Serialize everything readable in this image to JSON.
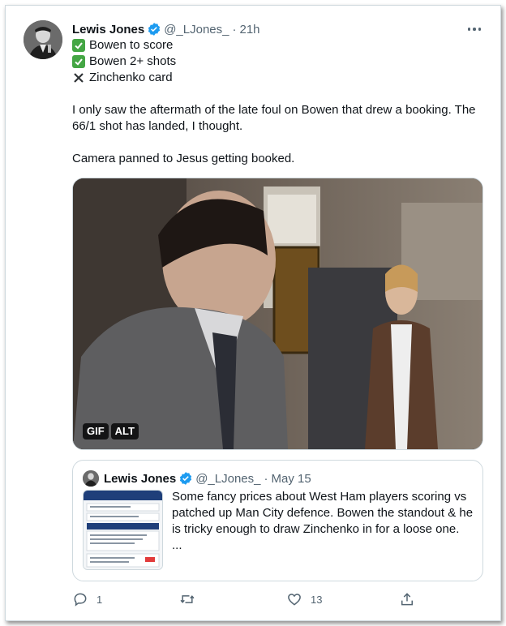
{
  "tweet": {
    "author_name": "Lewis Jones",
    "handle": "@_LJones_",
    "separator": "·",
    "time": "21h",
    "lines": [
      {
        "mark": "check",
        "text": "Bowen to score"
      },
      {
        "mark": "check",
        "text": "Bowen 2+ shots"
      },
      {
        "mark": "cross",
        "text": "Zinchenko card"
      }
    ],
    "paragraph_1": "I only saw the aftermath of the late foul on Bowen that drew a booking. The 66/1 shot has landed, I thought.",
    "paragraph_2": "Camera panned to Jesus getting booked.",
    "media": {
      "badge_gif": "GIF",
      "badge_alt": "ALT"
    }
  },
  "quote": {
    "author_name": "Lewis Jones",
    "handle": "@_LJones_",
    "separator": "·",
    "date": "May 15",
    "text": "Some fancy prices about West Ham players scoring vs patched up Man City defence. Bowen the standout & he is tricky enough to draw Zinchenko in for a loose one.",
    "ellipsis": "..."
  },
  "actions": {
    "reply_count": "1",
    "retweet_count": "",
    "like_count": "13"
  },
  "icons": {
    "verified": "verified-badge-icon",
    "more": "more-icon",
    "reply": "reply-icon",
    "retweet": "retweet-icon",
    "like": "like-icon",
    "share": "share-icon"
  },
  "colors": {
    "verified_blue": "#1d9bf0",
    "check_green": "#44a644",
    "secondary_text": "#536471",
    "border": "#cfd9de"
  }
}
